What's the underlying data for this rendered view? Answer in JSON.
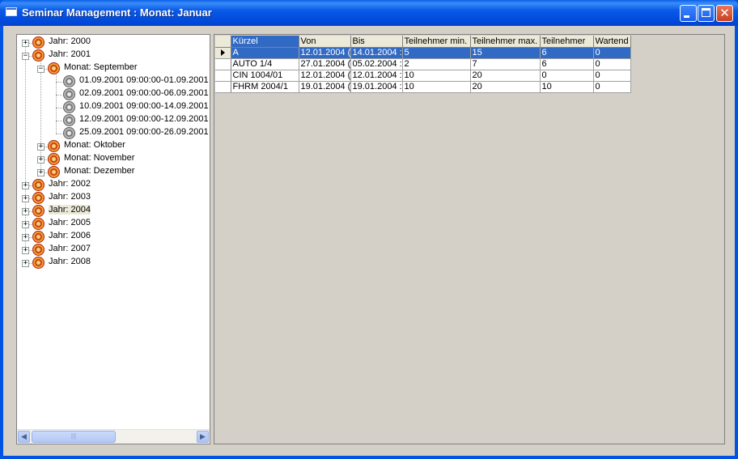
{
  "window": {
    "title": "Seminar Management : Monat: Januar"
  },
  "tree": {
    "nodes": [
      {
        "label": "Jahr: 2000",
        "level": 0,
        "expanded": false
      },
      {
        "label": "Jahr: 2001",
        "level": 0,
        "expanded": true
      },
      {
        "label": "Monat: September",
        "level": 1,
        "expanded": true
      },
      {
        "label": "01.09.2001 09:00:00-01.09.2001",
        "level": 2,
        "leaf": true
      },
      {
        "label": "02.09.2001 09:00:00-06.09.2001",
        "level": 2,
        "leaf": true
      },
      {
        "label": "10.09.2001 09:00:00-14.09.2001",
        "level": 2,
        "leaf": true
      },
      {
        "label": "12.09.2001 09:00:00-12.09.2001",
        "level": 2,
        "leaf": true
      },
      {
        "label": "25.09.2001 09:00:00-26.09.2001",
        "level": 2,
        "leaf": true
      },
      {
        "label": "Monat: Oktober",
        "level": 1,
        "expanded": false
      },
      {
        "label": "Monat: November",
        "level": 1,
        "expanded": false
      },
      {
        "label": "Monat: Dezember",
        "level": 1,
        "expanded": false
      },
      {
        "label": "Jahr: 2002",
        "level": 0,
        "expanded": false
      },
      {
        "label": "Jahr: 2003",
        "level": 0,
        "expanded": false
      },
      {
        "label": "Jahr: 2004",
        "level": 0,
        "expanded": false,
        "selected": true
      },
      {
        "label": "Jahr: 2005",
        "level": 0,
        "expanded": false
      },
      {
        "label": "Jahr: 2006",
        "level": 0,
        "expanded": false
      },
      {
        "label": "Jahr: 2007",
        "level": 0,
        "expanded": false
      },
      {
        "label": "Jahr: 2008",
        "level": 0,
        "expanded": false
      }
    ],
    "scroll_thumb_glyph": "|||"
  },
  "grid": {
    "columns": [
      "Kürzel",
      "Von",
      "Bis",
      "Teilnehmer min.",
      "Teilnehmer max.",
      "Teilnehmer",
      "Wartend"
    ],
    "rows": [
      [
        "A",
        "12.01.2004 (",
        "14.01.2004 :",
        "5",
        "15",
        "6",
        "0"
      ],
      [
        "AUTO 1/4",
        "27.01.2004 (",
        "05.02.2004 :",
        "2",
        "7",
        "6",
        "0"
      ],
      [
        "CIN 1004/01",
        "12.01.2004 (",
        "12.01.2004 :",
        "10",
        "20",
        "0",
        "0"
      ],
      [
        "FHRM 2004/1",
        "19.01.2004 (",
        "19.01.2004 :",
        "10",
        "20",
        "10",
        "0"
      ]
    ],
    "current_row": 0
  },
  "colors": {
    "title_bar": "#0a5ae8",
    "selection": "#316ac5",
    "face": "#d4d0c8"
  }
}
